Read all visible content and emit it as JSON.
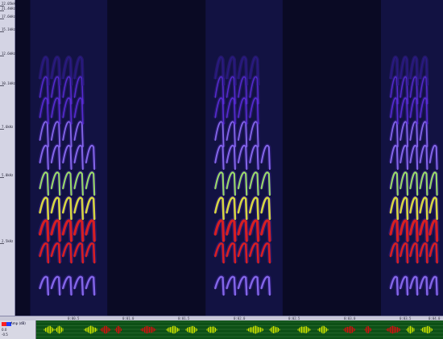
{
  "frequency_axis": {
    "tick_labels": [
      "22.05kHz",
      "21.4kHz",
      "17.6kHz",
      "15.1kHz",
      "12.6kHz",
      "10.1kHz",
      "7.6kHz",
      "5.0kHz",
      "2.5kHz"
    ]
  },
  "time_axis": {
    "tick_labels": [
      "0:00.5",
      "0:01.0",
      "0:01.5",
      "0:02.0",
      "0:02.5",
      "0:03.0",
      "0:03.5",
      "0:04.0"
    ]
  },
  "spectrogram": {
    "colormap": [
      "#2a1a8a",
      "#5a2cd8",
      "#8a6cf0",
      "#9fe06a",
      "#e0e040",
      "#e02020"
    ],
    "calls": [
      {
        "start": 0.05,
        "end": 0.2
      },
      {
        "start": 0.46,
        "end": 0.61
      },
      {
        "start": 0.87,
        "end": 1.0
      }
    ],
    "highlighted_segments": [
      {
        "start": 0.18,
        "end": 0.34
      },
      {
        "start": 0.76,
        "end": 0.9
      }
    ]
  },
  "waveform": {
    "label": "Amp (dB)",
    "side_labels": [
      "0.0",
      "-0.5"
    ],
    "color": "#c8e000",
    "selected_color": "#d01010",
    "grid_color": "#3b7a3e"
  },
  "legend": {
    "colors": [
      "#ff2020",
      "#2040ff"
    ]
  }
}
